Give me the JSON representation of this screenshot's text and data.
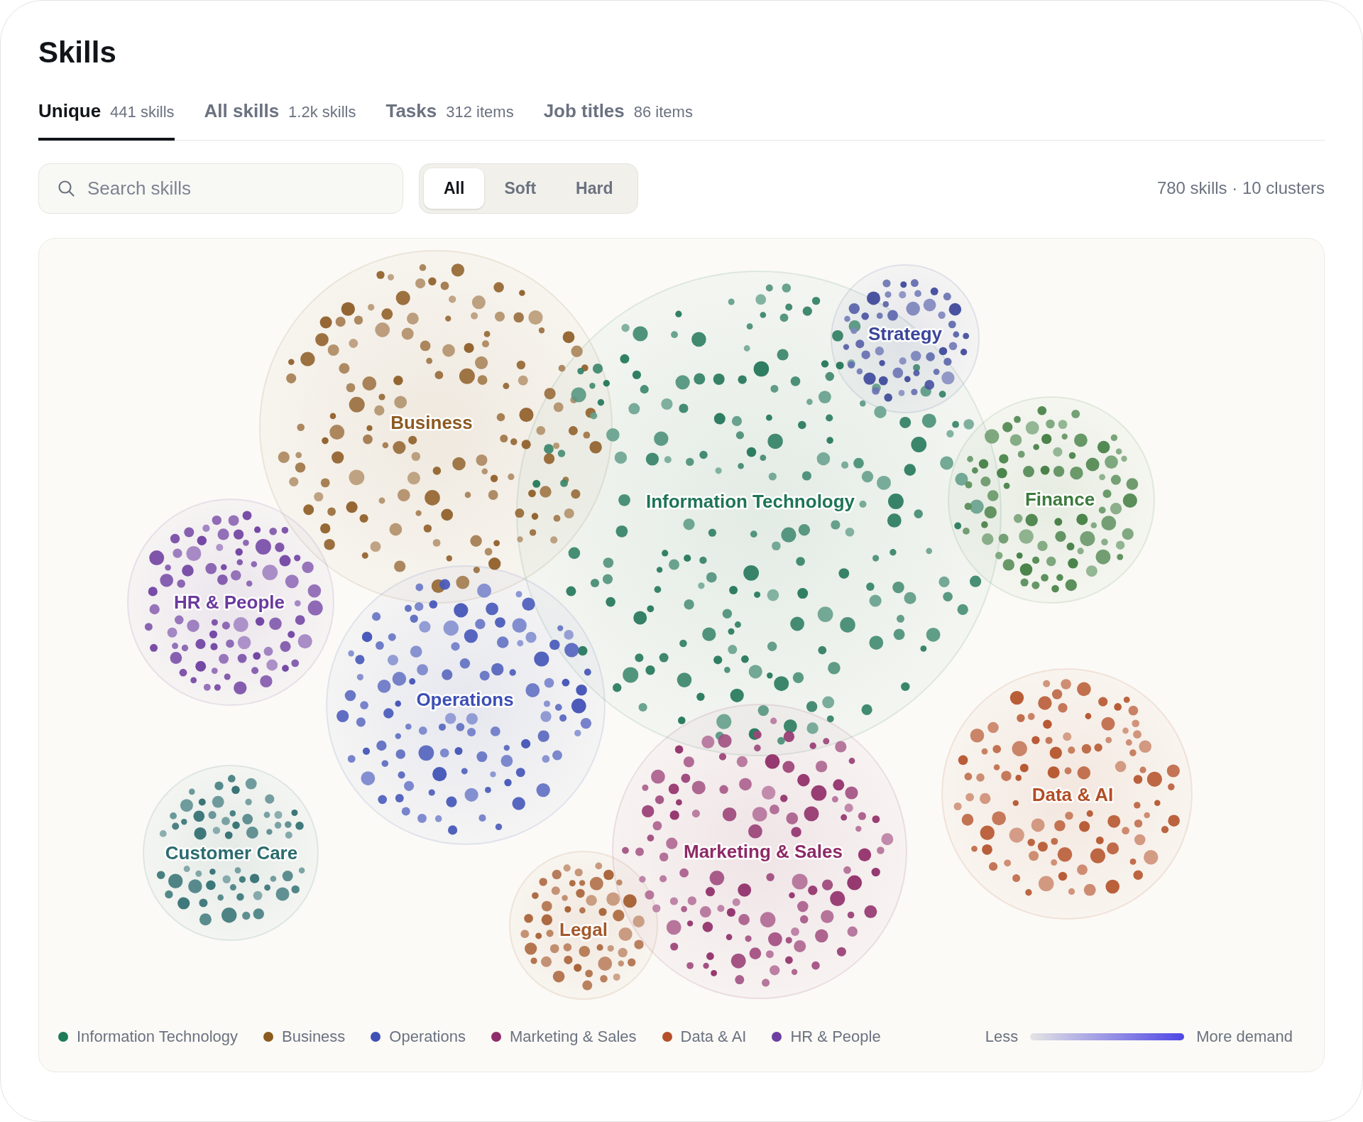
{
  "title": "Skills",
  "tabs": [
    {
      "label": "Unique",
      "count": "441 skills",
      "selected": true
    },
    {
      "label": "All skills",
      "count": "1.2k skills",
      "selected": false
    },
    {
      "label": "Tasks",
      "count": "312 items",
      "selected": false
    },
    {
      "label": "Job titles",
      "count": "86 items",
      "selected": false
    }
  ],
  "search": {
    "placeholder": "Search skills"
  },
  "skill_type_filter": [
    {
      "label": "All",
      "selected": true
    },
    {
      "label": "Soft",
      "selected": false
    },
    {
      "label": "Hard",
      "selected": false
    }
  ],
  "summary": "780 skills · 10 clusters",
  "clusters": [
    {
      "label": "Business",
      "color": "#8c5a22"
    },
    {
      "label": "Information Technology",
      "color": "#1e7456"
    },
    {
      "label": "Strategy",
      "color": "#3b469a"
    },
    {
      "label": "Finance",
      "color": "#3d7a3d"
    },
    {
      "label": "HR & People",
      "color": "#6a3a9e"
    },
    {
      "label": "Operations",
      "color": "#3d4fb5"
    },
    {
      "label": "Customer Care",
      "color": "#2b6b6e"
    },
    {
      "label": "Marketing & Sales",
      "color": "#8e2a66"
    },
    {
      "label": "Legal",
      "color": "#a3582a"
    },
    {
      "label": "Data & AI",
      "color": "#b24e25"
    }
  ],
  "legend": {
    "items": [
      {
        "label": "Information Technology",
        "color": "#1e7b5a"
      },
      {
        "label": "Business",
        "color": "#8b5a1f"
      },
      {
        "label": "Operations",
        "color": "#3f51b5"
      },
      {
        "label": "Marketing & Sales",
        "color": "#8e2d6a"
      },
      {
        "label": "Data & AI",
        "color": "#b5502a"
      },
      {
        "label": "HR & People",
        "color": "#6c3fa2"
      }
    ],
    "scale": {
      "low_label": "Less",
      "high_label": "More demand"
    }
  }
}
